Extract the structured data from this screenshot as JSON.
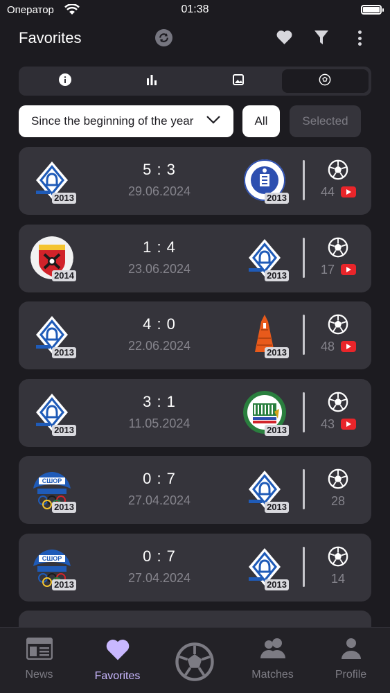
{
  "status_bar": {
    "carrier": "Оператор",
    "time": "01:38"
  },
  "header": {
    "title": "Favorites"
  },
  "segments": [
    {
      "icon": "info-icon",
      "active": false
    },
    {
      "icon": "bar-chart-icon",
      "active": false
    },
    {
      "icon": "image-icon",
      "active": false
    },
    {
      "icon": "soccer-ball-icon",
      "active": true
    }
  ],
  "filters": {
    "period": "Since the beginning of the year",
    "all_label": "All",
    "selected_label": "Selected"
  },
  "matches": [
    {
      "home": "dynamo",
      "home_year": "2013",
      "away": "tsarskoe-selo",
      "away_year": "2013",
      "score": "5 : 3",
      "date": "29.06.2024",
      "views": "44",
      "youtube": true
    },
    {
      "home": "avtovo",
      "home_year": "2014",
      "away": "dynamo",
      "away_year": "2013",
      "score": "1 : 4",
      "date": "23.06.2024",
      "views": "17",
      "youtube": true
    },
    {
      "home": "dynamo",
      "home_year": "2013",
      "away": "orange-tower",
      "away_year": "2013",
      "score": "4 : 0",
      "date": "22.06.2024",
      "views": "48",
      "youtube": true
    },
    {
      "home": "dynamo",
      "home_year": "2013",
      "away": "green-stadium",
      "away_year": "2013",
      "score": "3 : 1",
      "date": "11.05.2024",
      "views": "43",
      "youtube": true
    },
    {
      "home": "sshor",
      "home_year": "2013",
      "away": "dynamo",
      "away_year": "2013",
      "score": "0 : 7",
      "date": "27.04.2024",
      "views": "28",
      "youtube": false
    },
    {
      "home": "sshor",
      "home_year": "2013",
      "away": "dynamo",
      "away_year": "2013",
      "score": "0 : 7",
      "date": "27.04.2024",
      "views": "14",
      "youtube": false
    }
  ],
  "tabs": {
    "news": "News",
    "favorites": "Favorites",
    "matches": "Matches",
    "profile": "Profile"
  },
  "colors": {
    "background": "#1c1b20",
    "card": "#35343b",
    "accent": "#c9b8ff",
    "youtube": "#e9252a"
  }
}
